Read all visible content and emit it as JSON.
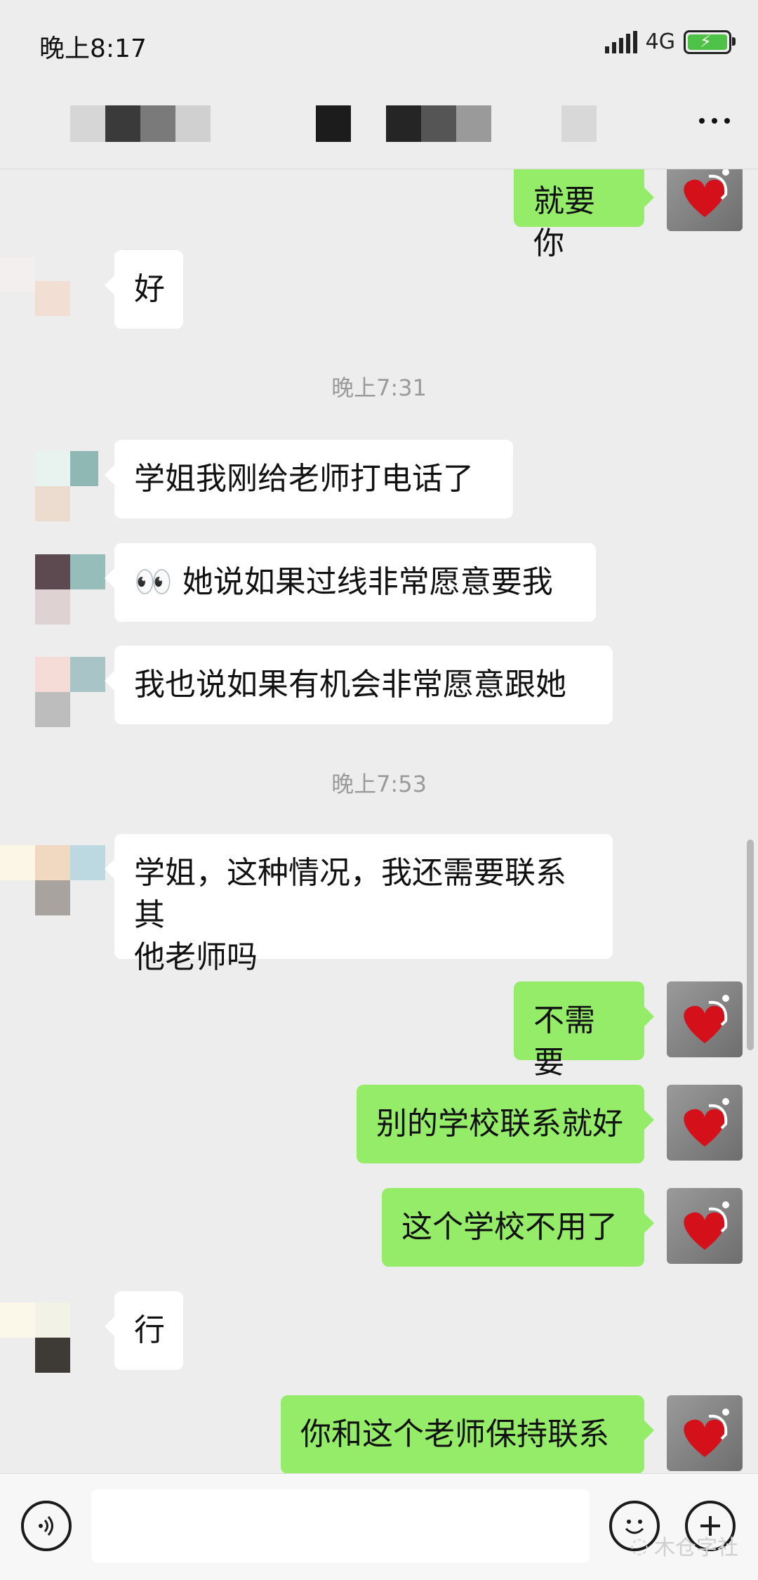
{
  "status_bar": {
    "time": "晚上8:17",
    "network": "4G"
  },
  "chat": {
    "messages": [
      {
        "side": "right",
        "text": "就要你"
      },
      {
        "side": "left",
        "text": "好"
      },
      {
        "type": "time",
        "text": "晚上7:31"
      },
      {
        "side": "left",
        "text": "学姐我刚给老师打电话了"
      },
      {
        "side": "left",
        "text": "👀 她说如果过线非常愿意要我"
      },
      {
        "side": "left",
        "text": "我也说如果有机会非常愿意跟她"
      },
      {
        "type": "time",
        "text": "晚上7:53"
      },
      {
        "side": "left",
        "text": "学姐，这种情况，我还需要联系其\n他老师吗"
      },
      {
        "side": "right",
        "text": "不需要"
      },
      {
        "side": "right",
        "text": "别的学校联系就好"
      },
      {
        "side": "right",
        "text": "这个学校不用了"
      },
      {
        "side": "left",
        "text": "行"
      },
      {
        "side": "right",
        "text": "你和这个老师保持联系"
      }
    ]
  },
  "input_bar": {
    "watermark": "木仓字社"
  },
  "colors": {
    "bubble_right": "#95ec69",
    "bubble_left": "#ffffff",
    "background": "#ededed"
  }
}
